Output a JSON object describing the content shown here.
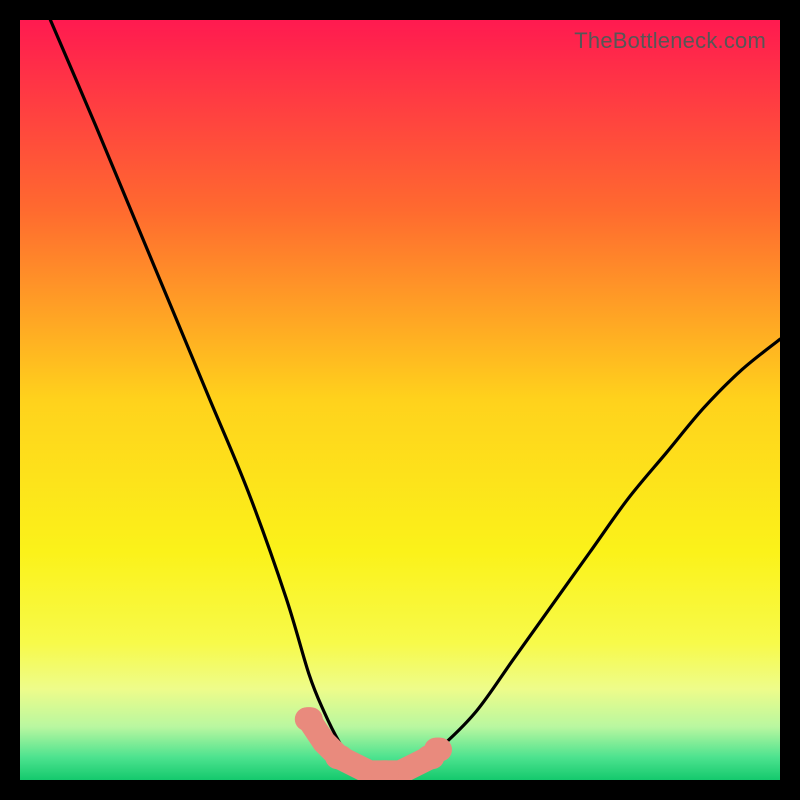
{
  "watermark": "TheBottleneck.com",
  "chart_data": {
    "type": "line",
    "title": "",
    "xlabel": "",
    "ylabel": "",
    "xlim": [
      0,
      100
    ],
    "ylim": [
      0,
      100
    ],
    "series": [
      {
        "name": "bottleneck-curve",
        "x": [
          4,
          10,
          15,
          20,
          25,
          30,
          35,
          38,
          40,
          42,
          44,
          46,
          48,
          50,
          52,
          55,
          60,
          65,
          70,
          75,
          80,
          85,
          90,
          95,
          100
        ],
        "values": [
          100,
          86,
          74,
          62,
          50,
          38,
          24,
          14,
          9,
          5,
          2,
          1,
          1,
          1,
          2,
          4,
          9,
          16,
          23,
          30,
          37,
          43,
          49,
          54,
          58
        ]
      }
    ],
    "markers": {
      "name": "highlight-band",
      "color": "#e98a7d",
      "x": [
        38,
        40,
        42,
        44,
        46,
        48,
        50,
        52,
        54,
        55
      ],
      "values": [
        8,
        5,
        3,
        2,
        1,
        1,
        1,
        2,
        3,
        4
      ]
    },
    "background_gradient": {
      "stops": [
        {
          "offset": 0.0,
          "color": "#ff1a50"
        },
        {
          "offset": 0.25,
          "color": "#ff6a2f"
        },
        {
          "offset": 0.5,
          "color": "#ffd21c"
        },
        {
          "offset": 0.7,
          "color": "#fbf21a"
        },
        {
          "offset": 0.82,
          "color": "#f7fa4a"
        },
        {
          "offset": 0.88,
          "color": "#eefc8a"
        },
        {
          "offset": 0.93,
          "color": "#b9f7a0"
        },
        {
          "offset": 0.97,
          "color": "#4de38f"
        },
        {
          "offset": 1.0,
          "color": "#14c96d"
        }
      ]
    }
  }
}
